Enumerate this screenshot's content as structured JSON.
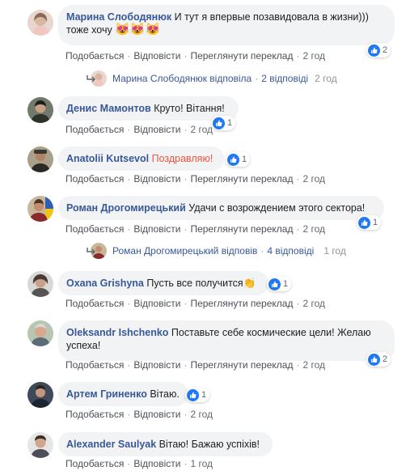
{
  "actions": {
    "like": "Подобається",
    "reply": "Відповісти",
    "translate": "Переглянути переклад"
  },
  "comments": [
    {
      "author": "Марина Слободянюк",
      "text": "И тут я впервые позавидовала в жизни)))",
      "text2": "тоже хочу",
      "emoji": "😻😻😻",
      "likes": "2",
      "time": "2 год",
      "reply_summary": {
        "name": "Марина Слободянюк",
        "verb": "відповіла",
        "count": "2 відповіді",
        "time": "2 год"
      }
    },
    {
      "author": "Денис Мамонтов",
      "text": "Круто! Вітання!",
      "likes": "1",
      "time": "2 год"
    },
    {
      "author": "Anatolii Kutsevol",
      "text": "Поздравляю!",
      "likes": "1",
      "time": "2 год"
    },
    {
      "author": "Роман Дрогомирецький",
      "text": "Удачи с возрождением этого сектора!",
      "likes": "1",
      "time": "2 год",
      "reply_summary": {
        "name": "Роман Дрогомирецький",
        "verb": "відповів",
        "count": "4 відповіді",
        "time": "1 год"
      }
    },
    {
      "author": "Oxana Grishyna",
      "text": "Пусть все получится",
      "emoji": "👏",
      "likes": "1",
      "time": "2 год"
    },
    {
      "author": "Oleksandr Ishchenko",
      "text": "Поставьте себе космические цели! Желаю",
      "text2": "успеха!",
      "likes": "2",
      "time": "2 год"
    },
    {
      "author": "Артем Гриненко",
      "text": "Вітаю.",
      "likes": "1",
      "time": "2 год"
    },
    {
      "author": "Alexander Saulyak",
      "text": "Вітаю! Бажаю успіхів!",
      "time": "1 год"
    }
  ],
  "icons": {
    "like": "thumbs-up-icon",
    "reply_arrow": "reply-arrow-icon"
  },
  "colors": {
    "author": "#385898",
    "like_blue": "#2078f4",
    "bubble_bg": "#f2f3f5",
    "meta": "#606770",
    "highlight": "#f0543c"
  }
}
